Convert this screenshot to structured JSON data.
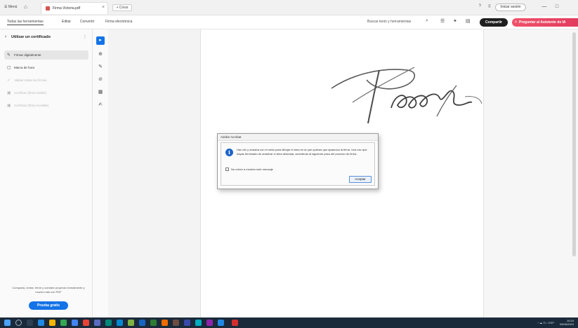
{
  "titlebar": {
    "menu_label": "☰ Menú",
    "tab_title": "Firma Victoria.pdf",
    "newtab_label": "+ Crear",
    "signin_label": "Iniciar sesión",
    "help_glyph": "?",
    "apps_glyph": "⠿",
    "minimize_glyph": "—",
    "restore_glyph": "□"
  },
  "menubar": {
    "items": [
      "Todas las herramientas",
      "Editar",
      "Convertir",
      "Firma electrónica"
    ],
    "search_placeholder": "Buscar texto y herramientas",
    "share_label": "Compartir",
    "ai_label": "Preguntar al Asistente de IA"
  },
  "leftpanel": {
    "title": "Utilizar un certificado",
    "items": [
      {
        "label": "Firmar digitalmente",
        "icon": "✎",
        "state": "active"
      },
      {
        "label": "Marca de hora",
        "icon": "▢",
        "state": "normal"
      },
      {
        "label": "Validar todas las firmas",
        "icon": "✓",
        "state": "disabled"
      },
      {
        "label": "Certificar (firma visible)",
        "icon": "▣",
        "state": "disabled"
      },
      {
        "label": "Certificar (firma invisible)",
        "icon": "▣",
        "state": "disabled"
      }
    ],
    "promo_text": "Comparta, revise, firme y contrate proyecto formalmente y mucho más con PDF",
    "cta_label": "Prueba gratis"
  },
  "toolstrip": {
    "tools": [
      "▸",
      "⊕",
      "✎",
      "⊘",
      "▦",
      "✍"
    ]
  },
  "dialog": {
    "title": "Adobe Acrobat",
    "message": "Haz clic y arrastra con el ratón para dibujar el área en la que quieras que aparezca la firma. Una vez que hayas terminado de arrastrar el área deseada, accederás al siguiente paso del proceso de firma.",
    "checkbox_label": "No volver a mostrar este mensaje",
    "ok_label": "Aceptar"
  },
  "taskbar": {
    "time": "10:24",
    "date": "05/06/2024",
    "tray_text": "^ ☁ ⊡ ♪ ESP"
  },
  "colors": {
    "accent": "#1473e6",
    "share": "#1f1f1f",
    "ai": "#e23b5e",
    "taskbar": "#1b2a3a"
  }
}
